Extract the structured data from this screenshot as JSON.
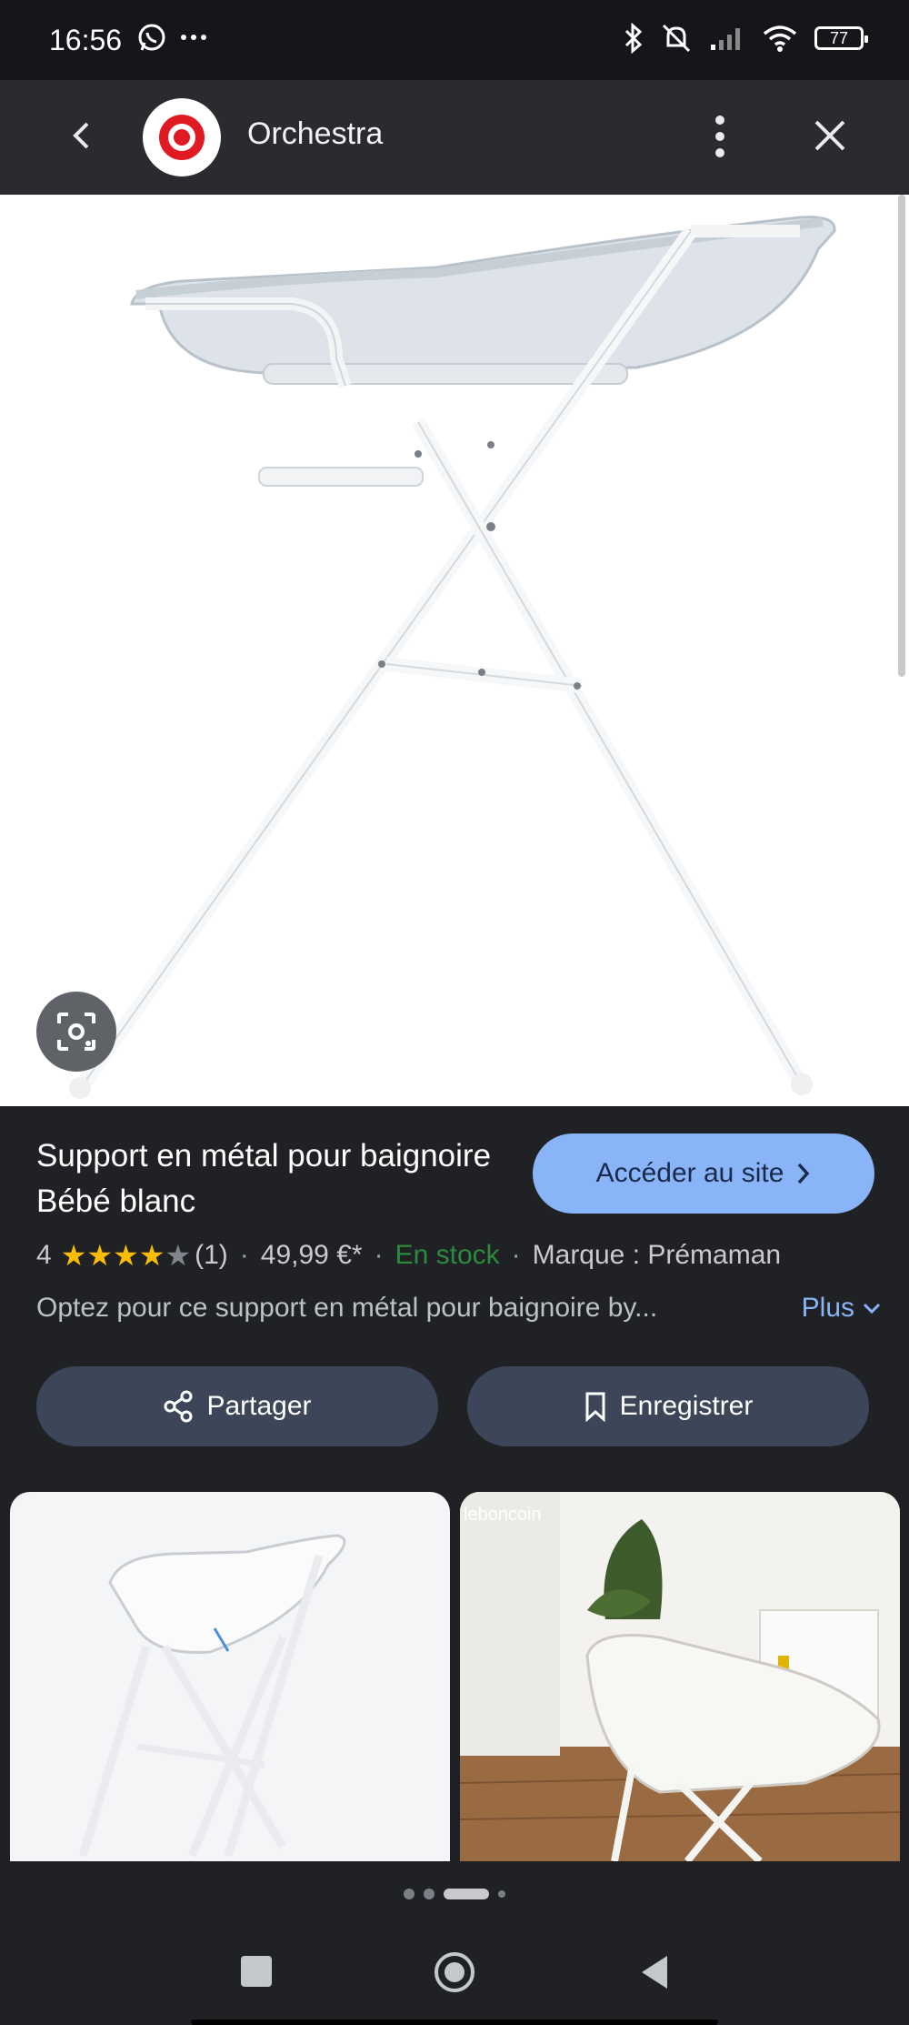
{
  "status_bar": {
    "time": "16:56",
    "battery": "77"
  },
  "header": {
    "site_name": "Orchestra"
  },
  "product": {
    "title": "Support en métal pour baignoire Bébé blanc",
    "visit_label": "Accéder au site",
    "rating_value": "4",
    "rating_stars": 4,
    "review_count": "(1)",
    "price": "49,99 €*",
    "stock": "En stock",
    "brand": "Marque : Prémaman",
    "description": "Optez pour ce support en métal pour baignoire by...",
    "more_label": "Plus"
  },
  "actions": {
    "share_label": "Partager",
    "save_label": "Enregistrer"
  },
  "thumbnails": [
    {
      "watermark": ""
    },
    {
      "watermark": "leboncoin"
    }
  ],
  "colors": {
    "accent": "#8ab4f8",
    "stock_green": "#2b8a3e",
    "star_gold": "#fbbc04",
    "logo_red": "#e01a22"
  },
  "icons": {
    "back": "chevron-left-icon",
    "more": "more-vert-icon",
    "close": "close-icon",
    "lens": "lens-icon",
    "share": "share-icon",
    "bookmark": "bookmark-icon"
  }
}
